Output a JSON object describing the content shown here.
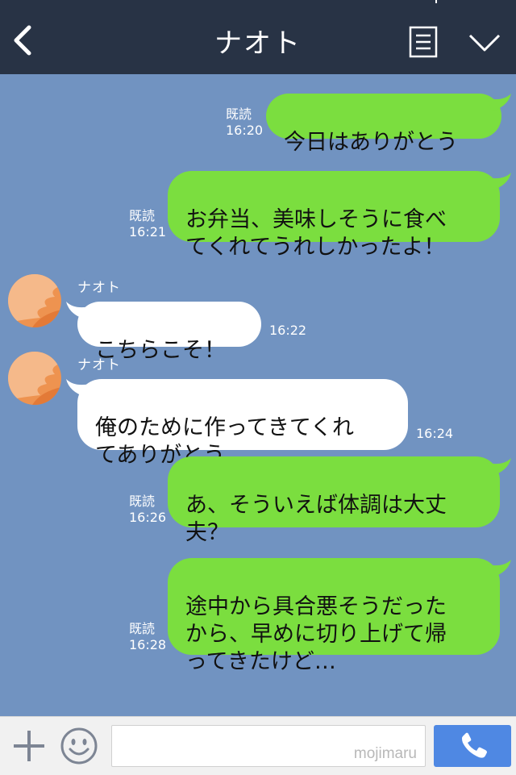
{
  "header": {
    "title": "ナオト"
  },
  "messages": [
    {
      "dir": "out",
      "text": "今日はありがとう",
      "read": "既読",
      "time": "16:20"
    },
    {
      "dir": "out",
      "text": "お弁当、美味しそうに食べ\nてくれてうれしかったよ！",
      "read": "既読",
      "time": "16:21"
    },
    {
      "dir": "in",
      "sender": "ナオト",
      "text": "こちらこそ！",
      "time": "16:22"
    },
    {
      "dir": "in",
      "sender": "ナオト",
      "text": "俺のために作ってきてくれ\nてありがとう",
      "time": "16:24"
    },
    {
      "dir": "out",
      "text": "あ、そういえば体調は大丈\n夫？",
      "read": "既読",
      "time": "16:26"
    },
    {
      "dir": "out",
      "text": "途中から具合悪そうだった\nから、早めに切り上げて帰\nってきたけど…",
      "read": "既読",
      "time": "16:28"
    }
  ],
  "footer": {
    "watermark": "mojimaru"
  },
  "colors": {
    "background": "#7193c1",
    "header": "#283345",
    "bubble_out": "#7bde3f",
    "bubble_in": "#ffffff",
    "call_button": "#4f88e3"
  },
  "icons": {
    "back": "back-chevron-icon",
    "menu": "menu-list-icon",
    "expand": "chevron-down-icon",
    "add": "plus-icon",
    "emoji": "smiley-icon",
    "call": "phone-icon"
  }
}
